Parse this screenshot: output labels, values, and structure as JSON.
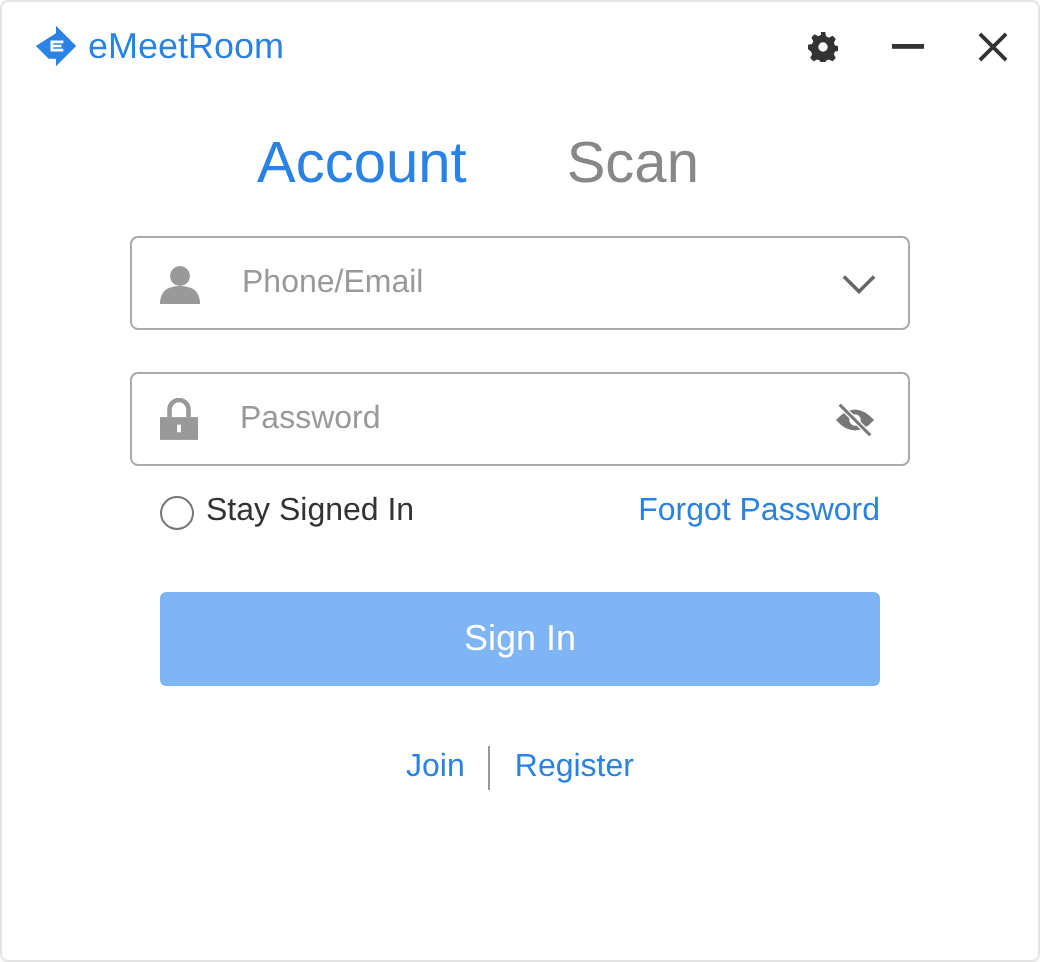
{
  "window": {
    "title": "eMeetRoom"
  },
  "tabs": [
    {
      "label": "Account",
      "selected": true
    },
    {
      "label": "Scan",
      "selected": false
    }
  ],
  "fields": [
    {
      "kind": "account",
      "placeholder": "Phone/Email"
    },
    {
      "kind": "password",
      "placeholder": "Password"
    }
  ],
  "stay_signed_in": {
    "label": "Stay Signed In",
    "checked": false
  },
  "forgot_password": "Forgot Password",
  "sign_in": {
    "label": "Sign In",
    "disabled": true
  },
  "links": [
    "Join",
    "Register"
  ]
}
